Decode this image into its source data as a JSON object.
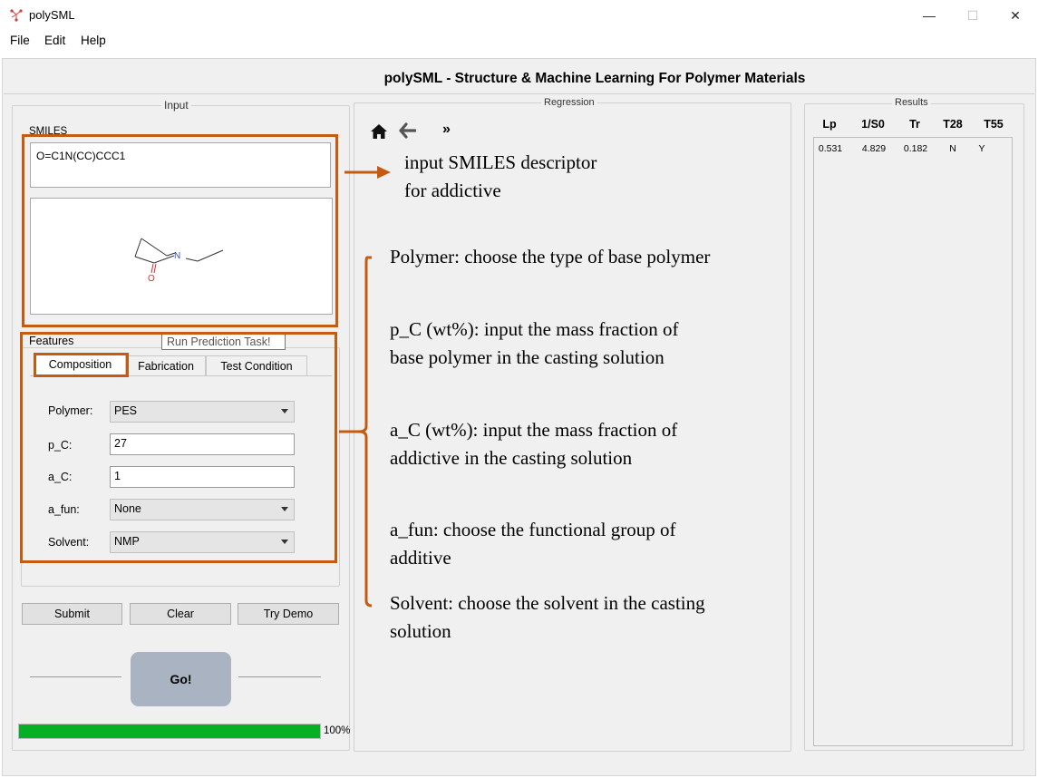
{
  "window": {
    "title": "polySML",
    "menu": [
      "File",
      "Edit",
      "Help"
    ],
    "controls": {
      "minimize": "—",
      "maximize": "☐",
      "close": "✕"
    }
  },
  "header": {
    "title": "polySML - Structure & Machine Learning For Polymer Materials"
  },
  "input_panel": {
    "title": "Input",
    "smiles_label": "SMILES",
    "smiles_value": "O=C1N(CC)CCC1",
    "molecule_atoms": {
      "nitrogen": "N",
      "oxygen": "O"
    }
  },
  "features": {
    "title": "Features",
    "tooltip": "Run Prediction Task!",
    "tabs": [
      "Composition",
      "Fabrication",
      "Test Condition"
    ],
    "fields": {
      "polymer": {
        "label": "Polymer:",
        "value": "PES"
      },
      "p_c": {
        "label": "p_C:",
        "value": "27"
      },
      "a_c": {
        "label": "a_C:",
        "value": "1"
      },
      "a_fun": {
        "label": "a_fun:",
        "value": "None"
      },
      "solvent": {
        "label": "Solvent:",
        "value": "NMP"
      }
    }
  },
  "buttons": {
    "submit": "Submit",
    "clear": "Clear",
    "try_demo": "Try Demo",
    "go": "Go!"
  },
  "progress": {
    "value": 1.0,
    "label": "100%"
  },
  "regression": {
    "title": "Regression",
    "toolbar": {
      "more": "»"
    }
  },
  "results": {
    "title": "Results",
    "columns": [
      "Lp",
      "1/S0",
      "Tr",
      "T28",
      "T55"
    ],
    "rows": [
      [
        "0.531",
        "4.829",
        "0.182",
        "N",
        "Y"
      ]
    ]
  },
  "annotations": {
    "smiles_1": "input SMILES descriptor",
    "smiles_2": "for addictive",
    "polymer": "Polymer: choose the type of  base polymer",
    "pc_1": "p_C (wt%): input the mass fraction of",
    "pc_2": "base polymer in the casting solution",
    "ac_1": "a_C (wt%): input the mass fraction of",
    "ac_2": "addictive in the casting solution",
    "afun_1": "a_fun: choose the functional group of",
    "afun_2": "additive",
    "solvent_1": "Solvent: choose the solvent in the casting",
    "solvent_2": "solution"
  },
  "colors": {
    "annotation": "#c55a11",
    "progress": "#06b025",
    "go_button": "#a9b3c1"
  }
}
